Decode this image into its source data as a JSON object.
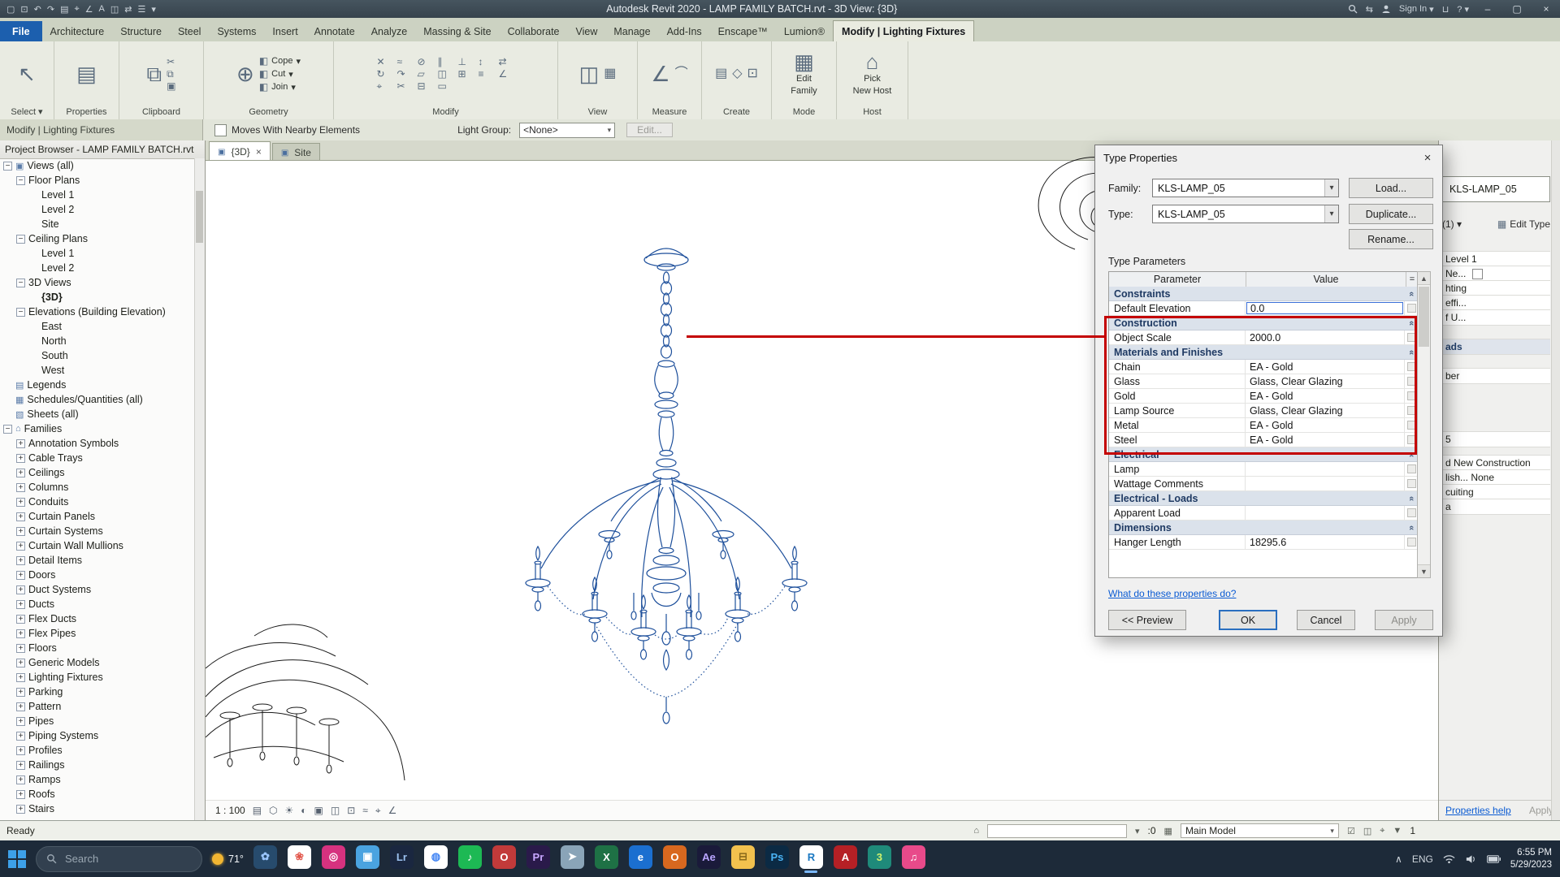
{
  "window": {
    "title": "Autodesk Revit 2020 - LAMP FAMILY BATCH.rvt - 3D View: {3D}",
    "sign_in": "Sign In"
  },
  "title_bar": {
    "qat_icons": [
      {
        "name": "open",
        "glyph": "▢"
      },
      {
        "name": "save",
        "glyph": "⊡"
      },
      {
        "name": "undo",
        "glyph": "↶"
      },
      {
        "name": "redo",
        "glyph": "↷"
      },
      {
        "name": "print",
        "glyph": "▤"
      },
      {
        "name": "measure",
        "glyph": "⌖"
      },
      {
        "name": "aligned-dimension",
        "glyph": "∠"
      },
      {
        "name": "text",
        "glyph": "A"
      },
      {
        "name": "3d-view",
        "glyph": "◫"
      },
      {
        "name": "section",
        "glyph": "⇄"
      },
      {
        "name": "thin-lines",
        "glyph": "☰"
      },
      {
        "name": "customize",
        "glyph": "▾"
      }
    ]
  },
  "ribbon": {
    "tabs": [
      {
        "label": "File",
        "style": "file"
      },
      {
        "label": "Architecture"
      },
      {
        "label": "Structure"
      },
      {
        "label": "Steel"
      },
      {
        "label": "Systems"
      },
      {
        "label": "Insert"
      },
      {
        "label": "Annotate"
      },
      {
        "label": "Analyze"
      },
      {
        "label": "Massing & Site"
      },
      {
        "label": "Collaborate"
      },
      {
        "label": "View"
      },
      {
        "label": "Manage"
      },
      {
        "label": "Add-Ins"
      },
      {
        "label": "Enscape™"
      },
      {
        "label": "Lumion®"
      },
      {
        "label": "Modify | Lighting Fixtures",
        "style": "active"
      }
    ],
    "panels": [
      {
        "label": "Select ▾",
        "buttons": [
          "Modify"
        ]
      },
      {
        "label": "Properties",
        "buttons": []
      },
      {
        "label": "Clipboard",
        "buttons": [
          "Paste"
        ]
      },
      {
        "label": "Geometry",
        "buttons": [
          "Cope",
          "Cut",
          "Join"
        ]
      },
      {
        "label": "Modify",
        "buttons": []
      },
      {
        "label": "View",
        "buttons": []
      },
      {
        "label": "Measure",
        "buttons": []
      },
      {
        "label": "Create",
        "buttons": []
      },
      {
        "label": "Mode",
        "buttons": [
          "Edit",
          "Family"
        ]
      },
      {
        "label": "Host",
        "buttons": [
          "Pick",
          "New Host"
        ]
      }
    ]
  },
  "options_bar": {
    "context": "Modify | Lighting Fixtures",
    "checkbox_label": "Moves With Nearby Elements",
    "light_group_label": "Light Group:",
    "light_group_value": "<None>",
    "edit_button": "Edit..."
  },
  "project_browser": {
    "title": "Project Browser - LAMP FAMILY BATCH.rvt",
    "items": [
      {
        "label": "Views (all)",
        "level": 0,
        "toggle": "-",
        "icon": "▣"
      },
      {
        "label": "Floor Plans",
        "level": 1,
        "toggle": "-",
        "icon": ""
      },
      {
        "label": "Level 1",
        "level": 2,
        "icon": ""
      },
      {
        "label": "Level 2",
        "level": 2,
        "icon": ""
      },
      {
        "label": "Site",
        "level": 2,
        "icon": ""
      },
      {
        "label": "Ceiling Plans",
        "level": 1,
        "toggle": "-",
        "icon": ""
      },
      {
        "label": "Level 1",
        "level": 2,
        "icon": ""
      },
      {
        "label": "Level 2",
        "level": 2,
        "icon": ""
      },
      {
        "label": "3D Views",
        "level": 1,
        "toggle": "-",
        "icon": ""
      },
      {
        "label": "{3D}",
        "level": 2,
        "icon": "",
        "bold": true
      },
      {
        "label": "Elevations (Building Elevation)",
        "level": 1,
        "toggle": "-",
        "icon": ""
      },
      {
        "label": "East",
        "level": 2,
        "icon": ""
      },
      {
        "label": "North",
        "level": 2,
        "icon": ""
      },
      {
        "label": "South",
        "level": 2,
        "icon": ""
      },
      {
        "label": "West",
        "level": 2,
        "icon": ""
      },
      {
        "label": "Legends",
        "level": 0,
        "icon": "▤"
      },
      {
        "label": "Schedules/Quantities (all)",
        "level": 0,
        "icon": "▦"
      },
      {
        "label": "Sheets (all)",
        "level": 0,
        "icon": "▧"
      },
      {
        "label": "Families",
        "level": 0,
        "toggle": "-",
        "icon": "⌂"
      },
      {
        "label": "Annotation Symbols",
        "level": 1,
        "toggle": "+",
        "icon": ""
      },
      {
        "label": "Cable Trays",
        "level": 1,
        "toggle": "+",
        "icon": ""
      },
      {
        "label": "Ceilings",
        "level": 1,
        "toggle": "+",
        "icon": ""
      },
      {
        "label": "Columns",
        "level": 1,
        "toggle": "+",
        "icon": ""
      },
      {
        "label": "Conduits",
        "level": 1,
        "toggle": "+",
        "icon": ""
      },
      {
        "label": "Curtain Panels",
        "level": 1,
        "toggle": "+",
        "icon": ""
      },
      {
        "label": "Curtain Systems",
        "level": 1,
        "toggle": "+",
        "icon": ""
      },
      {
        "label": "Curtain Wall Mullions",
        "level": 1,
        "toggle": "+",
        "icon": ""
      },
      {
        "label": "Detail Items",
        "level": 1,
        "toggle": "+",
        "icon": ""
      },
      {
        "label": "Doors",
        "level": 1,
        "toggle": "+",
        "icon": ""
      },
      {
        "label": "Duct Systems",
        "level": 1,
        "toggle": "+",
        "icon": ""
      },
      {
        "label": "Ducts",
        "level": 1,
        "toggle": "+",
        "icon": ""
      },
      {
        "label": "Flex Ducts",
        "level": 1,
        "toggle": "+",
        "icon": ""
      },
      {
        "label": "Flex Pipes",
        "level": 1,
        "toggle": "+",
        "icon": ""
      },
      {
        "label": "Floors",
        "level": 1,
        "toggle": "+",
        "icon": ""
      },
      {
        "label": "Generic Models",
        "level": 1,
        "toggle": "+",
        "icon": ""
      },
      {
        "label": "Lighting Fixtures",
        "level": 1,
        "toggle": "+",
        "icon": ""
      },
      {
        "label": "Parking",
        "level": 1,
        "toggle": "+",
        "icon": ""
      },
      {
        "label": "Pattern",
        "level": 1,
        "toggle": "+",
        "icon": ""
      },
      {
        "label": "Pipes",
        "level": 1,
        "toggle": "+",
        "icon": ""
      },
      {
        "label": "Piping Systems",
        "level": 1,
        "toggle": "+",
        "icon": ""
      },
      {
        "label": "Profiles",
        "level": 1,
        "toggle": "+",
        "icon": ""
      },
      {
        "label": "Railings",
        "level": 1,
        "toggle": "+",
        "icon": ""
      },
      {
        "label": "Ramps",
        "level": 1,
        "toggle": "+",
        "icon": ""
      },
      {
        "label": "Roofs",
        "level": 1,
        "toggle": "+",
        "icon": ""
      },
      {
        "label": "Stairs",
        "level": 1,
        "toggle": "+",
        "icon": ""
      }
    ]
  },
  "canvas": {
    "tabs": [
      {
        "label": "{3D}",
        "active": true,
        "close": "×"
      },
      {
        "label": "Site",
        "active": false,
        "close": ""
      }
    ],
    "view_scale": "1 : 100",
    "vcb_icons": [
      {
        "name": "detail-level",
        "glyph": "▤"
      },
      {
        "name": "visual-style",
        "glyph": "⬡"
      },
      {
        "name": "sun-path",
        "glyph": "☀"
      },
      {
        "name": "shadows",
        "glyph": "◐"
      },
      {
        "name": "crop-view",
        "glyph": "▣"
      },
      {
        "name": "crop-region",
        "glyph": "◫"
      },
      {
        "name": "temporary-hide",
        "glyph": "⊡"
      },
      {
        "name": "reveal-hidden",
        "glyph": "≈"
      },
      {
        "name": "analytical-model",
        "glyph": "⌖"
      },
      {
        "name": "constraints",
        "glyph": "∠"
      }
    ]
  },
  "type_properties": {
    "title": "Type Properties",
    "family_label": "Family:",
    "family_value": "KLS-LAMP_05",
    "type_label": "Type:",
    "type_value": "KLS-LAMP_05",
    "load_button": "Load...",
    "duplicate_button": "Duplicate...",
    "rename_button": "Rename...",
    "section_label": "Type Parameters",
    "col_parameter": "Parameter",
    "col_value": "Value",
    "col_eq": "=",
    "rows": [
      {
        "kind": "group",
        "label": "Constraints"
      },
      {
        "kind": "param",
        "label": "Default Elevation",
        "value": "0.0",
        "editing": true
      },
      {
        "kind": "group",
        "label": "Construction"
      },
      {
        "kind": "param",
        "label": "Object Scale",
        "value": "2000.0"
      },
      {
        "kind": "group",
        "label": "Materials and Finishes"
      },
      {
        "kind": "param",
        "label": "Chain",
        "value": "EA - Gold"
      },
      {
        "kind": "param",
        "label": "Glass",
        "value": "Glass, Clear Glazing"
      },
      {
        "kind": "param",
        "label": "Gold",
        "value": "EA - Gold"
      },
      {
        "kind": "param",
        "label": "Lamp Source",
        "value": "Glass, Clear Glazing"
      },
      {
        "kind": "param",
        "label": "Metal",
        "value": "EA - Gold"
      },
      {
        "kind": "param",
        "label": "Steel",
        "value": "EA - Gold"
      },
      {
        "kind": "group",
        "label": "Electrical"
      },
      {
        "kind": "param",
        "label": "Lamp",
        "value": ""
      },
      {
        "kind": "param",
        "label": "Wattage Comments",
        "value": ""
      },
      {
        "kind": "group",
        "label": "Electrical - Loads"
      },
      {
        "kind": "param",
        "label": "Apparent Load",
        "value": ""
      },
      {
        "kind": "group",
        "label": "Dimensions"
      },
      {
        "kind": "param",
        "label": "Hanger Length",
        "value": "18295.6"
      }
    ],
    "help_link": "What do these properties do?",
    "preview_button": "<< Preview",
    "ok_button": "OK",
    "cancel_button": "Cancel",
    "apply_button": "Apply"
  },
  "properties_palette": {
    "type_name": "KLS-LAMP_05",
    "selector_fragment": "(1)",
    "edit_type": "Edit Type",
    "fragments": [
      {
        "text": "Level 1",
        "kind": "cell"
      },
      {
        "text": "Ne...",
        "kind": "cell-check"
      },
      {
        "text": "hting",
        "kind": "cell"
      },
      {
        "text": "effi...",
        "kind": "cell"
      },
      {
        "text": "f U...",
        "kind": "cell"
      },
      {
        "text": "ads",
        "kind": "header"
      },
      {
        "text": "ber",
        "kind": "cell"
      },
      {
        "text": "5",
        "kind": "cell"
      },
      {
        "text": "d    New Construction",
        "kind": "cell"
      },
      {
        "text": "lish...   None",
        "kind": "cell"
      },
      {
        "text": "cuiting",
        "kind": "cell"
      },
      {
        "text": "a",
        "kind": "cell"
      }
    ],
    "help_link": "Properties help",
    "apply_button": "Apply"
  },
  "status_bar": {
    "ready": "Ready",
    "badge_zero": ":0",
    "main_model": "Main Model",
    "filter_count": "1"
  },
  "taskbar": {
    "search_placeholder": "Search",
    "weather_temp": "71°",
    "apps": [
      {
        "name": "photos-dark",
        "label": "✿",
        "bg": "#274b6d",
        "fg": "#9cc7ff"
      },
      {
        "name": "photos",
        "label": "❀",
        "bg": "#ffffff",
        "fg": "#e2574c"
      },
      {
        "name": "instagram",
        "label": "◎",
        "bg": "#d6327f",
        "fg": "#ffffff"
      },
      {
        "name": "gallery",
        "label": "▣",
        "bg": "#4aa3e0",
        "fg": "#ffffff"
      },
      {
        "name": "lightroom",
        "label": "Lr",
        "bg": "#1a2740",
        "fg": "#9bc1ef"
      },
      {
        "name": "chrome",
        "label": "◍",
        "bg": "#ffffff",
        "fg": "#4285f4"
      },
      {
        "name": "spotify",
        "label": "♪",
        "bg": "#1db954",
        "fg": "#ffffff"
      },
      {
        "name": "opera",
        "label": "O",
        "bg": "#c23a3a",
        "fg": "#ffffff"
      },
      {
        "name": "premiere",
        "label": "Pr",
        "bg": "#2a1a4a",
        "fg": "#c8a6ff"
      },
      {
        "name": "telegram",
        "label": "➤",
        "bg": "#8aa4b8",
        "fg": "#ffffff"
      },
      {
        "name": "excel",
        "label": "X",
        "bg": "#1e7145",
        "fg": "#ffffff"
      },
      {
        "name": "edge",
        "label": "e",
        "bg": "#1b6fd0",
        "fg": "#ffffff"
      },
      {
        "name": "outlook",
        "label": "O",
        "bg": "#d8681f",
        "fg": "#ffffff"
      },
      {
        "name": "after-effects",
        "label": "Ae",
        "bg": "#1a1a3a",
        "fg": "#b9a5ff"
      },
      {
        "name": "folder",
        "label": "⊟",
        "bg": "#f2c14e",
        "fg": "#8a6a1a"
      },
      {
        "name": "photoshop",
        "label": "Ps",
        "bg": "#0b2a44",
        "fg": "#4ab3f4"
      },
      {
        "name": "revit",
        "label": "R",
        "bg": "#ffffff",
        "fg": "#1a78c2",
        "active": true
      },
      {
        "name": "acrobat",
        "label": "A",
        "bg": "#b52025",
        "fg": "#ffffff"
      },
      {
        "name": "3ds-max",
        "label": "3",
        "bg": "#1f8a7a",
        "fg": "#d2f26c"
      },
      {
        "name": "music",
        "label": "♫",
        "bg": "#e84a8a",
        "fg": "#ffffff"
      }
    ],
    "lang": "ENG",
    "time": "6:55 PM",
    "date": "5/29/2023"
  }
}
